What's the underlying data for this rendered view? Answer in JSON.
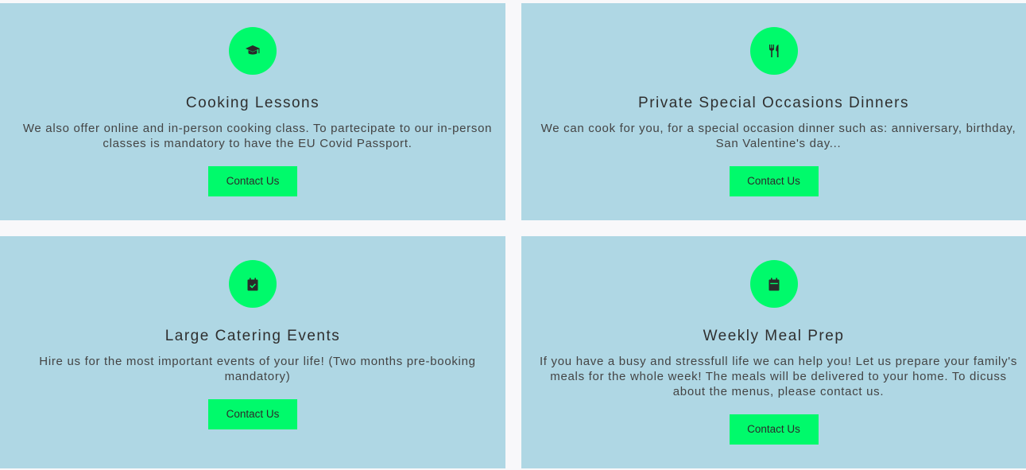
{
  "colors": {
    "page_background": "#f8f8fa",
    "card_background": "#afd7e4",
    "accent_green": "#00fa6b",
    "text_dark": "#2f2f2f"
  },
  "services": [
    {
      "icon": "graduation-cap-icon",
      "title": "Cooking Lessons",
      "description": "We also offer online and in-person cooking class. To partecipate to our in-person classes is mandatory to have the EU Covid Passport.",
      "button_label": "Contact Us"
    },
    {
      "icon": "utensils-icon",
      "title": "Private Special Occasions Dinners",
      "description": "We can cook for you, for a special occasion dinner such as: anniversary, birthday, San Valentine's day...",
      "button_label": "Contact Us"
    },
    {
      "icon": "calendar-check-icon",
      "title": "Large Catering Events",
      "description": "Hire us for the most important events of your life! (Two months pre-booking mandatory)",
      "button_label": "Contact Us"
    },
    {
      "icon": "calendar-icon",
      "title": "Weekly Meal Prep",
      "description": "If you have a busy and stressfull life we can help you! Let us prepare your family's meals for the whole week! The meals will be delivered to your home. To dicuss about the menus, please contact us.",
      "button_label": "Contact Us"
    }
  ]
}
